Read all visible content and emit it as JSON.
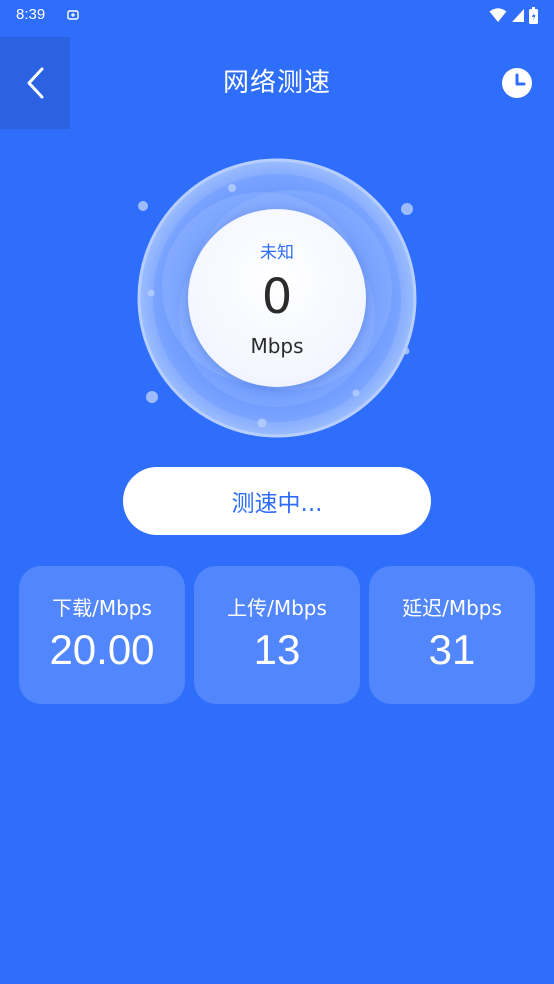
{
  "status_bar": {
    "time": "8:39",
    "icons": [
      "sync-icon",
      "wifi-icon",
      "signal-icon",
      "battery-icon"
    ]
  },
  "header": {
    "title": "网络测速",
    "back_icon": "chevron-left-icon",
    "history_icon": "clock-icon"
  },
  "gauge": {
    "status": "未知",
    "value": "0",
    "unit": "Mbps"
  },
  "test_button": {
    "label": "测速中..."
  },
  "stats": [
    {
      "label": "下载/Mbps",
      "value": "20.00"
    },
    {
      "label": "上传/Mbps",
      "value": "13"
    },
    {
      "label": "延迟/Mbps",
      "value": "31"
    }
  ],
  "colors": {
    "background": "#2f6dfb",
    "card": "#5286fc",
    "accent": "#2f6dfb"
  }
}
